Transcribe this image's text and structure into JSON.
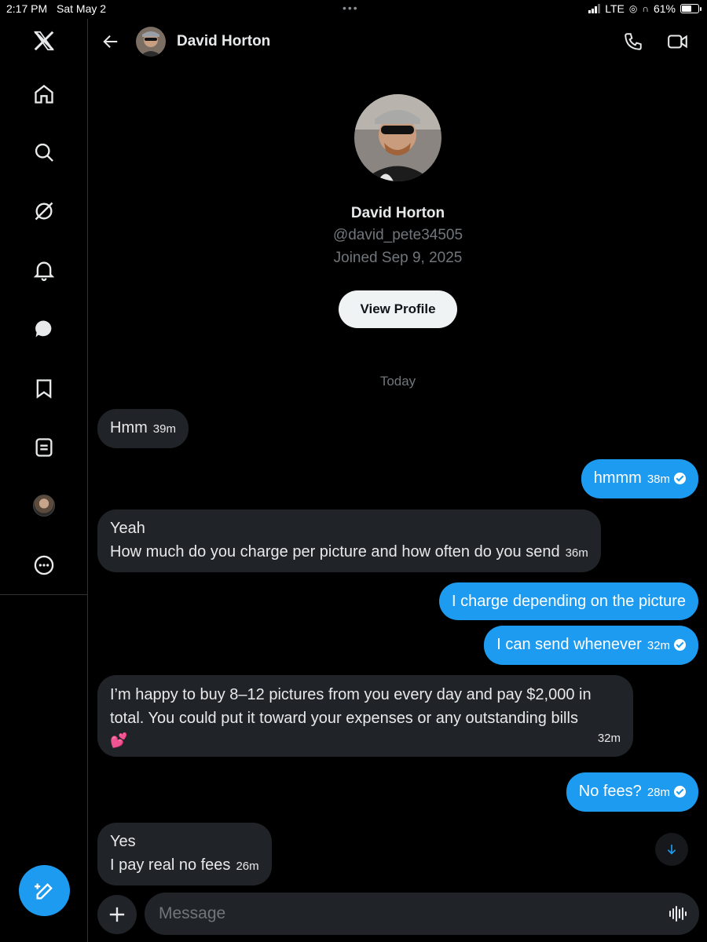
{
  "status_bar": {
    "time": "2:17 PM",
    "date": "Sat May 2",
    "network": "LTE",
    "battery": "61%",
    "battery_level": 0.61
  },
  "nav": {
    "items": [
      "x-logo-icon",
      "home-icon",
      "search-icon",
      "grok-icon",
      "notifications-icon",
      "messages-icon",
      "bookmarks-icon",
      "lists-icon",
      "profile-avatar",
      "more-icon"
    ],
    "compose_icon": "compose-icon"
  },
  "header": {
    "name": "David Horton"
  },
  "profile": {
    "name": "David Horton",
    "handle": "@david_pete34505",
    "joined": "Joined Sep 9, 2025",
    "view_profile_label": "View Profile"
  },
  "date_separator": "Today",
  "messages": [
    {
      "direction": "in",
      "lines": [
        "Hmm"
      ],
      "time": "39m"
    },
    {
      "direction": "out",
      "lines": [
        "hmmm"
      ],
      "time": "38m",
      "read": true
    },
    {
      "direction": "in",
      "lines": [
        "Yeah",
        "How much do you charge per picture and how often do you send"
      ],
      "time": "36m"
    },
    {
      "direction": "out",
      "lines": [
        "I charge depending on the picture"
      ]
    },
    {
      "direction": "out",
      "lines": [
        "I can send whenever"
      ],
      "time": "32m",
      "read": true
    },
    {
      "direction": "in",
      "lines": [
        "I’m happy to buy 8–12 pictures from you every day and pay $2,000 in",
        "total. You could put it toward your expenses or any outstanding bills",
        "💕"
      ],
      "time": "32m"
    },
    {
      "direction": "out",
      "lines": [
        "No fees?"
      ],
      "time": "28m",
      "read": true
    },
    {
      "direction": "in",
      "lines": [
        "Yes",
        "I pay real no fees"
      ],
      "time": "26m"
    }
  ],
  "composer": {
    "placeholder": "Message"
  },
  "colors": {
    "accent": "#1d9bf0",
    "background": "#000000",
    "incoming_bubble": "#202327",
    "muted_text": "#71767b"
  }
}
